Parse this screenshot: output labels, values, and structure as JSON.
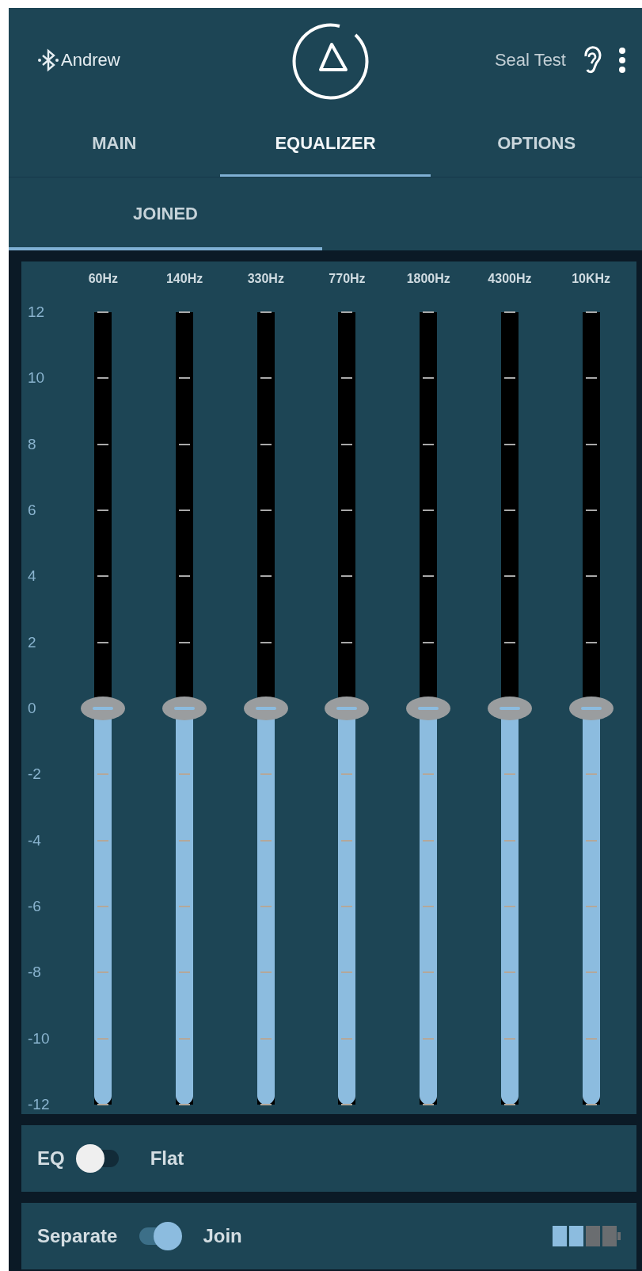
{
  "header": {
    "device": "Andrew",
    "seal_test": "Seal Test"
  },
  "tabs": [
    {
      "label": "MAIN",
      "selected": false
    },
    {
      "label": "EQUALIZER",
      "selected": true
    },
    {
      "label": "OPTIONS",
      "selected": false
    }
  ],
  "subtabs": [
    {
      "label": "JOINED",
      "selected": true
    }
  ],
  "scale": [
    "12",
    "10",
    "8",
    "6",
    "4",
    "2",
    "0",
    "-2",
    "-4",
    "-6",
    "-8",
    "-10",
    "-12"
  ],
  "bands": [
    {
      "label": "60Hz",
      "level": 0.5
    },
    {
      "label": "140Hz",
      "level": 0.5
    },
    {
      "label": "330Hz",
      "level": 0.5
    },
    {
      "label": "770Hz",
      "level": 0.5
    },
    {
      "label": "1800Hz",
      "level": 0.5
    },
    {
      "label": "4300Hz",
      "level": 0.5
    },
    {
      "label": "10KHz",
      "level": 0.5
    }
  ],
  "eq_row": {
    "label": "EQ",
    "on": false,
    "preset": "Flat"
  },
  "join_row": {
    "left_label": "Separate",
    "on": true,
    "right_label": "Join"
  }
}
